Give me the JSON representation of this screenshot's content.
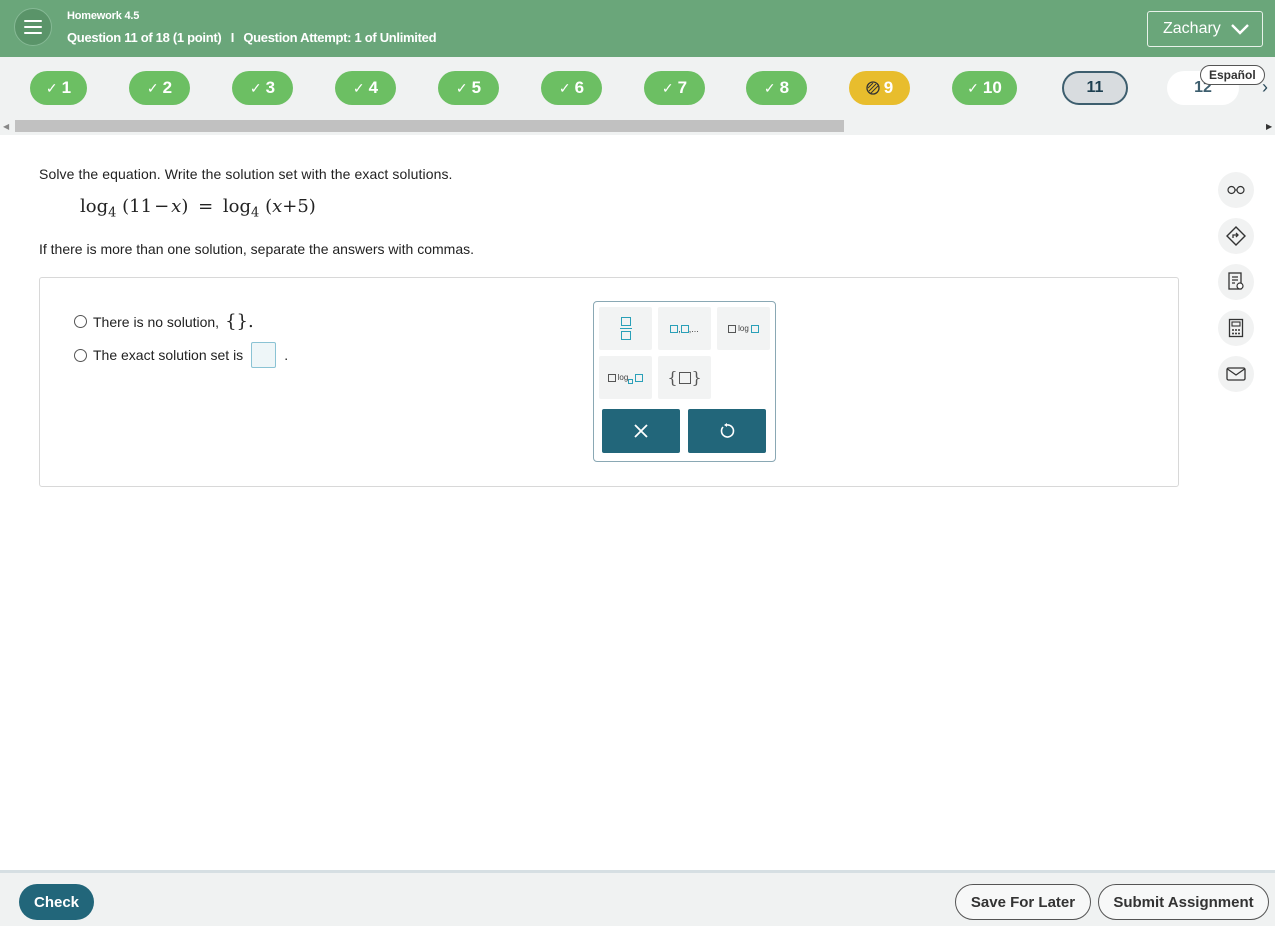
{
  "header": {
    "homework_title": "Homework 4.5",
    "question_label": "Question 11 of 18 (1 point)",
    "separator": "I",
    "attempt_label": "Question Attempt: 1 of Unlimited",
    "user_name": "Zachary",
    "colors": {
      "header_bg": "#6aa67a",
      "accent": "#22667a",
      "correct": "#6cbf63",
      "partial": "#e8bd2d"
    }
  },
  "question_nav": {
    "questions": [
      {
        "number": "1",
        "status": "correct"
      },
      {
        "number": "2",
        "status": "correct"
      },
      {
        "number": "3",
        "status": "correct"
      },
      {
        "number": "4",
        "status": "correct"
      },
      {
        "number": "5",
        "status": "correct"
      },
      {
        "number": "6",
        "status": "correct"
      },
      {
        "number": "7",
        "status": "correct"
      },
      {
        "number": "8",
        "status": "correct"
      },
      {
        "number": "9",
        "status": "partial"
      },
      {
        "number": "10",
        "status": "correct"
      },
      {
        "number": "11",
        "status": "current"
      },
      {
        "number": "12",
        "status": "unanswered"
      }
    ],
    "language_label": "Español"
  },
  "question": {
    "prompt": "Solve the equation. Write the solution set with the exact solutions.",
    "equation": {
      "lhs_fn": "log",
      "lhs_base": "4",
      "lhs_open": "(11",
      "lhs_minus": "−",
      "lhs_var": "x",
      "lhs_close": ")",
      "equals": "=",
      "rhs_fn": "log",
      "rhs_base": "4",
      "rhs_open": "(",
      "rhs_var": "x",
      "rhs_plus": "+",
      "rhs_close": "5)"
    },
    "instruction": "If there is more than one solution, separate the answers with commas."
  },
  "answer": {
    "choice_no_solution": "There is no solution,",
    "empty_set_symbol": "{}.",
    "choice_solution_set": "The exact solution set is",
    "trailing_period": "."
  },
  "palette": {
    "comma_list_suffix": ",...",
    "log_label": "log"
  },
  "footer": {
    "check_label": "Check",
    "save_label": "Save For Later",
    "submit_label": "Submit Assignment"
  }
}
